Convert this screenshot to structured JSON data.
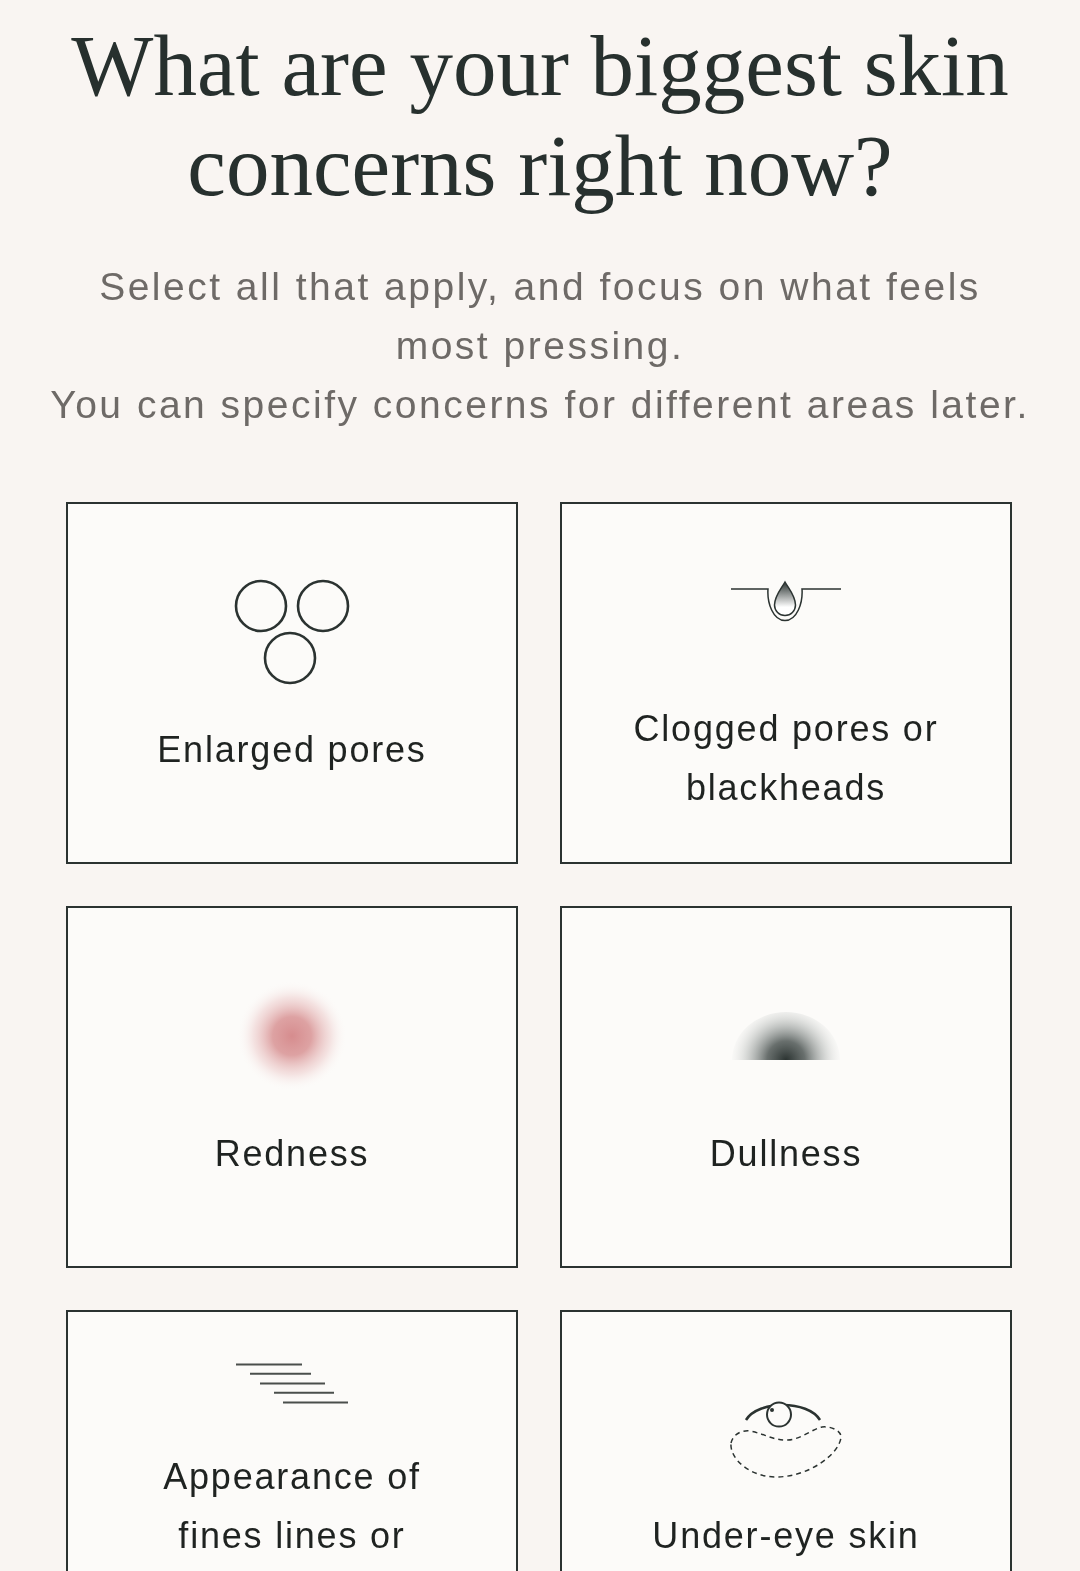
{
  "title": "What are your biggest skin concerns right now?",
  "intro": [
    "Select all that apply, and focus on what feels most pressing.",
    "You can specify concerns for different areas later."
  ],
  "options": [
    {
      "label": "Enlarged pores",
      "kind": "pores",
      "selected": false
    },
    {
      "label": "Clogged pores or blackheads",
      "kind": "clogged",
      "selected": false
    },
    {
      "label": "Redness",
      "kind": "redness",
      "selected": false
    },
    {
      "label": "Dullness",
      "kind": "dullness",
      "selected": false
    },
    {
      "label": "Appearance of fines lines or",
      "kind": "lines",
      "selected": false
    },
    {
      "label": "Under-eye skin",
      "kind": "under-eye",
      "selected": false
    }
  ]
}
